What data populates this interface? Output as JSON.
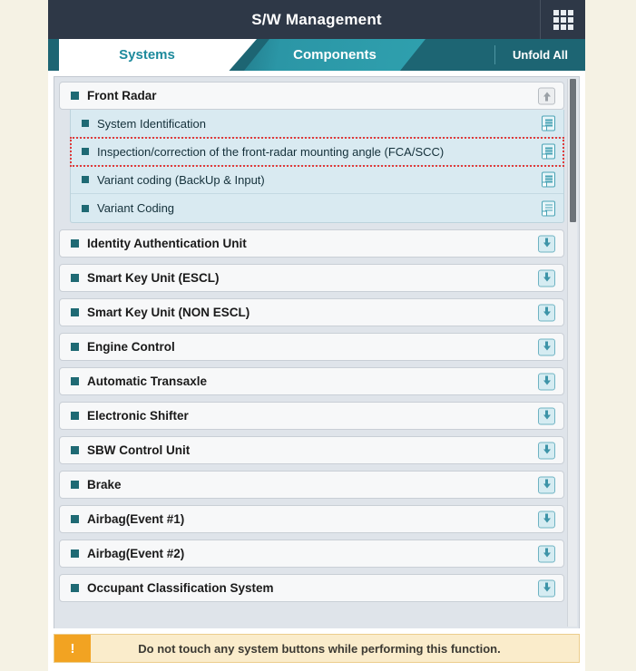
{
  "titlebar": {
    "title": "S/W Management",
    "grid_icon": "apps-grid-icon"
  },
  "tabs": [
    {
      "label": "Systems",
      "active": true
    },
    {
      "label": "Components",
      "active": false
    }
  ],
  "toolbar": {
    "unfold_all_label": "Unfold All"
  },
  "list": {
    "groups": [
      {
        "label": "Front Radar",
        "expanded": true,
        "toggle_icon": "arrow-up-collapse-icon",
        "items": [
          {
            "label": "System Identification",
            "selected": false,
            "icon": "document-icon"
          },
          {
            "label": "Inspection/correction of the front-radar mounting angle (FCA/SCC)",
            "selected": true,
            "icon": "document-icon"
          },
          {
            "label": "Variant coding (BackUp & Input)",
            "selected": false,
            "icon": "document-icon"
          },
          {
            "label": "Variant Coding",
            "selected": false,
            "icon": "document-icon"
          }
        ]
      },
      {
        "label": "Identity Authentication Unit",
        "expanded": false,
        "toggle_icon": "arrow-down-expand-icon",
        "items": []
      },
      {
        "label": "Smart Key Unit (ESCL)",
        "expanded": false,
        "toggle_icon": "arrow-down-expand-icon",
        "items": []
      },
      {
        "label": "Smart Key Unit (NON ESCL)",
        "expanded": false,
        "toggle_icon": "arrow-down-expand-icon",
        "items": []
      },
      {
        "label": "Engine Control",
        "expanded": false,
        "toggle_icon": "arrow-down-expand-icon",
        "items": []
      },
      {
        "label": "Automatic Transaxle",
        "expanded": false,
        "toggle_icon": "arrow-down-expand-icon",
        "items": []
      },
      {
        "label": "Electronic Shifter",
        "expanded": false,
        "toggle_icon": "arrow-down-expand-icon",
        "items": []
      },
      {
        "label": "SBW Control Unit",
        "expanded": false,
        "toggle_icon": "arrow-down-expand-icon",
        "items": []
      },
      {
        "label": "Brake",
        "expanded": false,
        "toggle_icon": "arrow-down-expand-icon",
        "items": []
      },
      {
        "label": "Airbag(Event #1)",
        "expanded": false,
        "toggle_icon": "arrow-down-expand-icon",
        "items": []
      },
      {
        "label": "Airbag(Event #2)",
        "expanded": false,
        "toggle_icon": "arrow-down-expand-icon",
        "items": []
      },
      {
        "label": "Occupant Classification System",
        "expanded": false,
        "toggle_icon": "arrow-down-expand-icon",
        "items": []
      }
    ]
  },
  "footer": {
    "badge": "!",
    "message": "Do not touch any system buttons while performing this function."
  },
  "colors": {
    "titlebar_bg": "#2e3847",
    "tabbar_bg": "#1d6573",
    "tab_active_text": "#1d8a9c",
    "accent_teal": "#1f6a74",
    "sub_item_bg": "#d9eaf1",
    "selection_outline": "#e03b3b",
    "warning_badge": "#f2a322",
    "warning_bg": "#faeccb",
    "page_bg": "#f5f2e4"
  }
}
